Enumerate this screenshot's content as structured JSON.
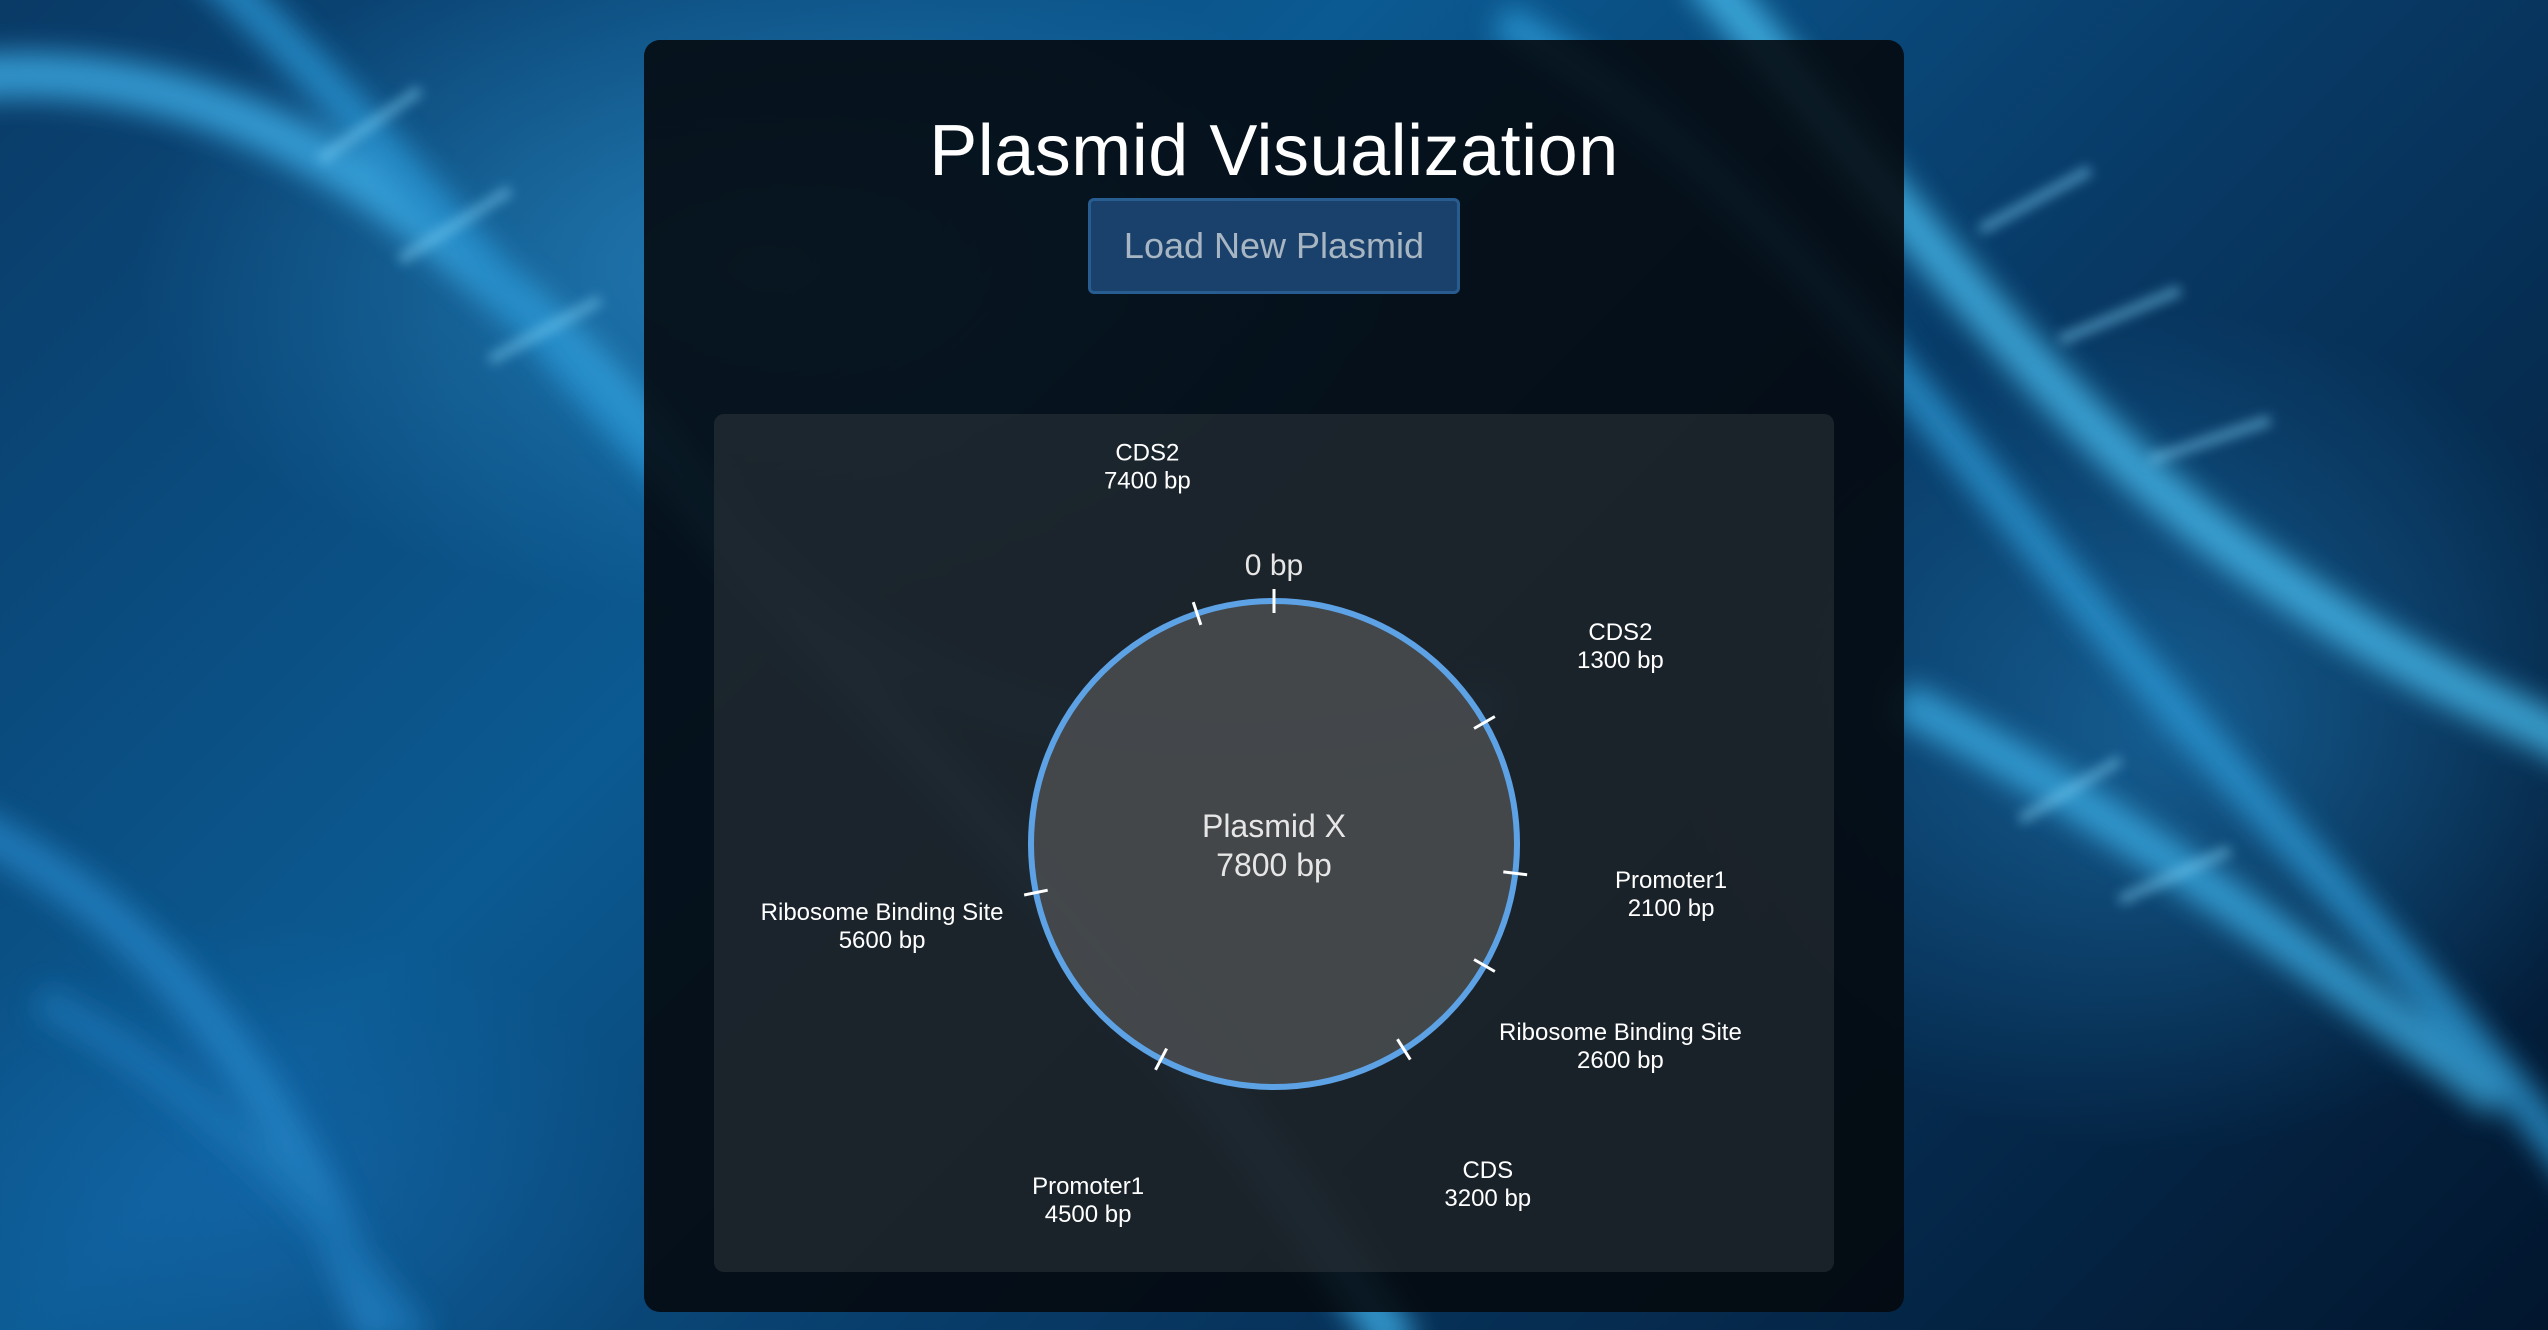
{
  "page": {
    "title": "Plasmid Visualization",
    "load_button_label": "Load New Plasmid"
  },
  "plasmid": {
    "name": "Plasmid X",
    "length_label": "7800 bp",
    "total_length_bp": 7800,
    "origin_label": "0 bp",
    "features": [
      {
        "name": "CDS2",
        "position_label": "1300 bp",
        "position": 1300
      },
      {
        "name": "Promoter1",
        "position_label": "2100 bp",
        "position": 2100
      },
      {
        "name": "Ribosome Binding Site",
        "position_label": "2600 bp",
        "position": 2600
      },
      {
        "name": "CDS",
        "position_label": "3200 bp",
        "position": 3200
      },
      {
        "name": "Promoter1",
        "position_label": "4500 bp",
        "position": 4500
      },
      {
        "name": "Ribosome Binding Site",
        "position_label": "5600 bp",
        "position": 5600
      },
      {
        "name": "CDS2",
        "position_label": "7400 bp",
        "position": 7400
      }
    ]
  },
  "colors": {
    "ring": "#5ea2e6",
    "ring_fill": "#4a4d50",
    "tick": "#ffffff",
    "button_bg": "#1d4a7a"
  },
  "icons": {
    "background": "dna-helix-illustration"
  }
}
